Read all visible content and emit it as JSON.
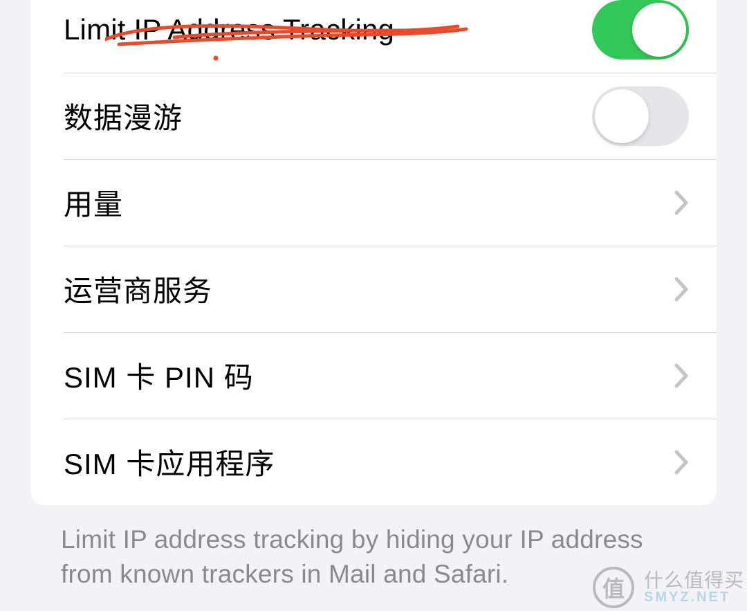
{
  "colors": {
    "toggle_on": "#34c759",
    "toggle_off": "#e5e5ea",
    "chevron": "#c5c5c8",
    "annotation": "#e94a2b"
  },
  "rows": {
    "limit_ip": {
      "label": "Limit IP Address Tracking",
      "toggle": true
    },
    "roaming": {
      "label": "数据漫游",
      "toggle": false
    },
    "usage": {
      "label": "用量"
    },
    "carrier": {
      "label": "运营商服务"
    },
    "sim_pin": {
      "label": "SIM 卡 PIN 码"
    },
    "sim_apps": {
      "label": "SIM 卡应用程序"
    }
  },
  "footer": "Limit IP address tracking by hiding your IP address from known trackers in Mail and Safari.",
  "watermark": {
    "badge": "值",
    "line1": "什么值得买",
    "line2": "SMYZ.NET"
  }
}
